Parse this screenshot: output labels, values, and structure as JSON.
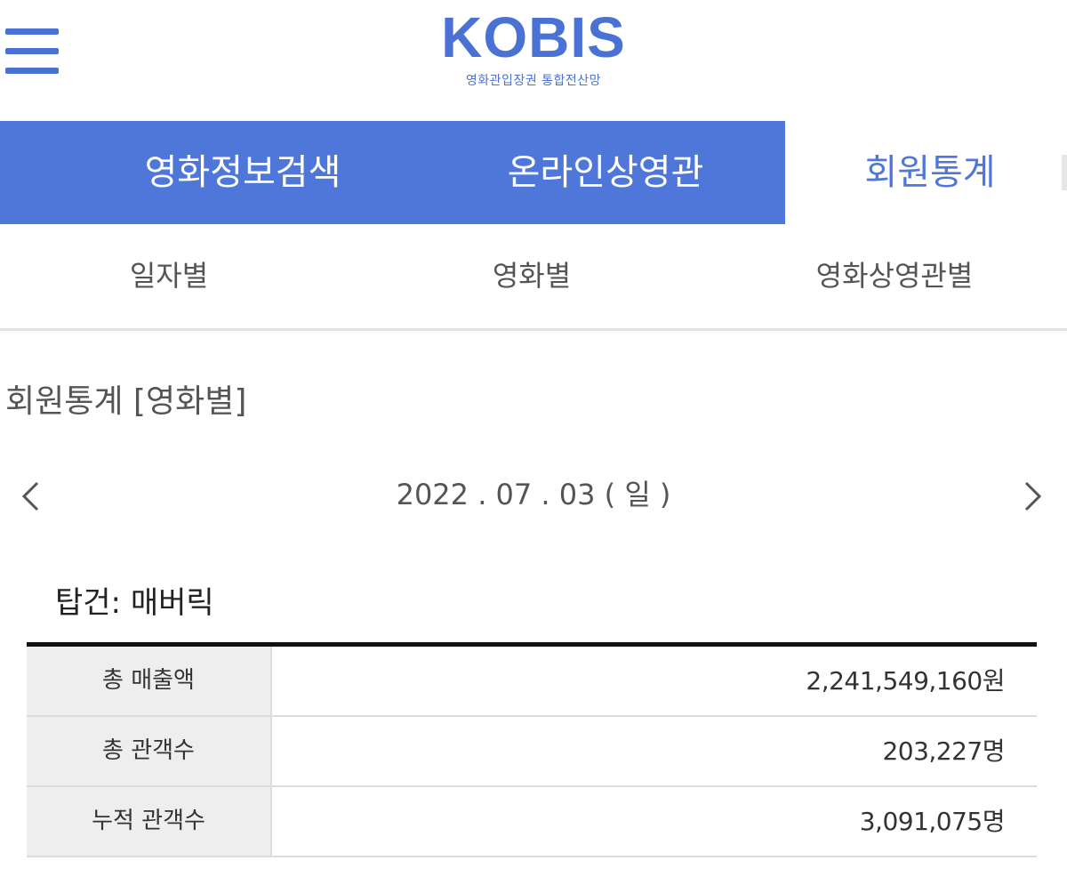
{
  "header": {
    "logo_main": "KOBIS",
    "logo_sub": "영화관입장권 통합전산망",
    "menu_icon": "hamburger-menu-icon",
    "accent_color": "#4f76d9"
  },
  "main_nav": {
    "tabs": [
      {
        "label": "영화정보검색",
        "active": false
      },
      {
        "label": "온라인상영관",
        "active": false
      },
      {
        "label": "회원통계",
        "active": true
      }
    ]
  },
  "sub_nav": {
    "tabs": [
      {
        "label": "일자별"
      },
      {
        "label": "영화별"
      },
      {
        "label": "영화상영관별"
      }
    ]
  },
  "page_title": "회원통계 [영화별]",
  "date_nav": {
    "date": "2022 . 07 . 03 ( 일 )",
    "prev_icon": "chevron-left-icon",
    "next_icon": "chevron-right-icon"
  },
  "movie_name": "탑건: 매버릭",
  "stats": {
    "rows": [
      {
        "label": "총 매출액",
        "value": "2,241,549,160원"
      },
      {
        "label": "총 관객수",
        "value": "203,227명"
      },
      {
        "label": "누적 관객수",
        "value": "3,091,075명"
      }
    ]
  }
}
